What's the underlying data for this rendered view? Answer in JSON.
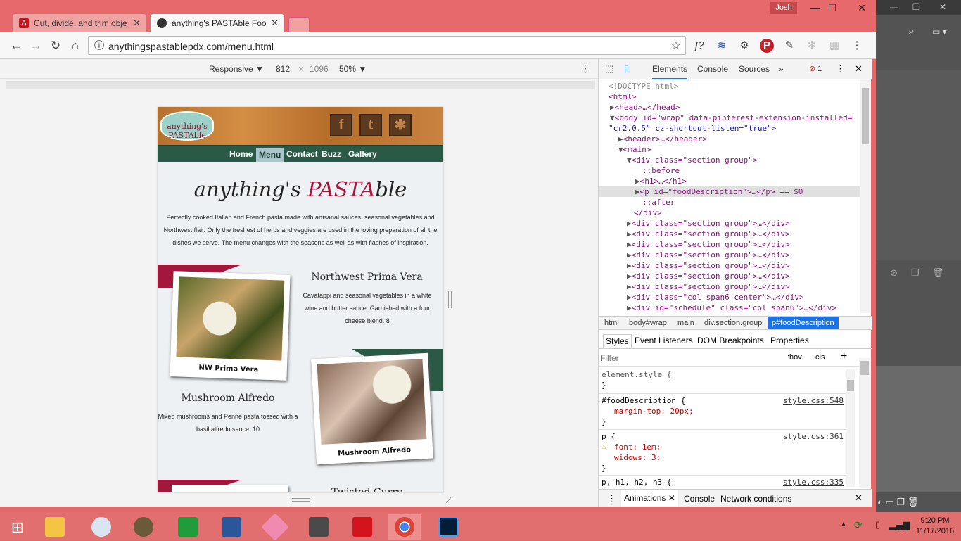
{
  "browser": {
    "user": "Josh",
    "tabs": [
      {
        "title": "Cut, divide, and trim obje",
        "active": false
      },
      {
        "title": "anything's PASTAble Foo",
        "active": true
      }
    ],
    "url": "anythingspastablepdx.com/menu.html"
  },
  "device_toolbar": {
    "mode": "Responsive",
    "width": "812",
    "times": "×",
    "height": "1096",
    "zoom": "50%"
  },
  "site": {
    "logo": "anything's PASTAble",
    "nav": [
      "Home",
      "Menu",
      "Contact",
      "Buzz",
      "Gallery"
    ],
    "title_a": "anything's ",
    "title_b": "PASTA",
    "title_c": "ble",
    "description": "Perfectly cooked Italian and French pasta made with artisanal sauces, seasonal vegetables and Northwest flair. Only the freshest of herbs and veggies are used in the loving preparation of all the dishes we serve. The menu changes with the seasons as well as with flashes of inspiration.",
    "dishes": [
      {
        "name": "Northwest Prima Vera",
        "caption": "NW Prima Vera",
        "desc": "Cavatappi and seasonal vegetables in a white wine and butter sauce. Garnished with a four cheese blend. 8"
      },
      {
        "name": "Mushroom Alfredo",
        "caption": "Mushroom Alfredo",
        "desc": "Mixed mushrooms and Penne pasta tossed with a basil alfredo sauce. 10"
      },
      {
        "name": "Twisted Curry"
      }
    ]
  },
  "devtools": {
    "tabs": [
      "Elements",
      "Console",
      "Sources",
      "»"
    ],
    "error_count": "1",
    "dom": [
      "<!DOCTYPE html>",
      "<html>",
      "<head>…</head>",
      "<body id=\"wrap\" data-pinterest-extension-installed=",
      "\"cr2.0.5\" cz-shortcut-listen=\"true\">",
      "<header>…</header>",
      "<main>",
      "<div class=\"section group\">",
      "::before",
      "<h1>…</h1>",
      "<p id=\"foodDescription\">…</p> == $0",
      "::after",
      "</div>",
      "<div class=\"section group\">…</div>",
      "<div class=\"section group\">…</div>",
      "<div class=\"section group\">…</div>",
      "<div class=\"section group\">…</div>",
      "<div class=\"section group\">…</div>",
      "<div class=\"section group\">…</div>",
      "<div class=\"section group\">…</div>",
      "<div class=\"col span6 center\">…</div>",
      "<div id=\"schedule\" class=\"col span6\">…</div>"
    ],
    "breadcrumbs": [
      "html",
      "body#wrap",
      "main",
      "div.section.group",
      "p#foodDescription"
    ],
    "style_tabs": [
      "Styles",
      "Event Listeners",
      "DOM Breakpoints",
      "Properties"
    ],
    "filter_placeholder": "Filter",
    "hov": ":hov",
    "cls": ".cls",
    "rules": [
      {
        "selector": "element.style {",
        "close": "}"
      },
      {
        "selector": "#foodDescription {",
        "source": "style.css:548",
        "props": [
          "margin-top: 20px;"
        ],
        "close": "}"
      },
      {
        "selector": "p {",
        "source": "style.css:361",
        "props": [
          "font: 1em;",
          "widows: 3;"
        ],
        "close": "}"
      },
      {
        "selector": "p, h1, h2, h3 {",
        "source": "style.css:335"
      }
    ],
    "drawer_tabs": [
      "Animations",
      "Console",
      "Network conditions"
    ]
  },
  "taskbar": {
    "time": "9:20 PM",
    "date": "11/17/2016"
  }
}
